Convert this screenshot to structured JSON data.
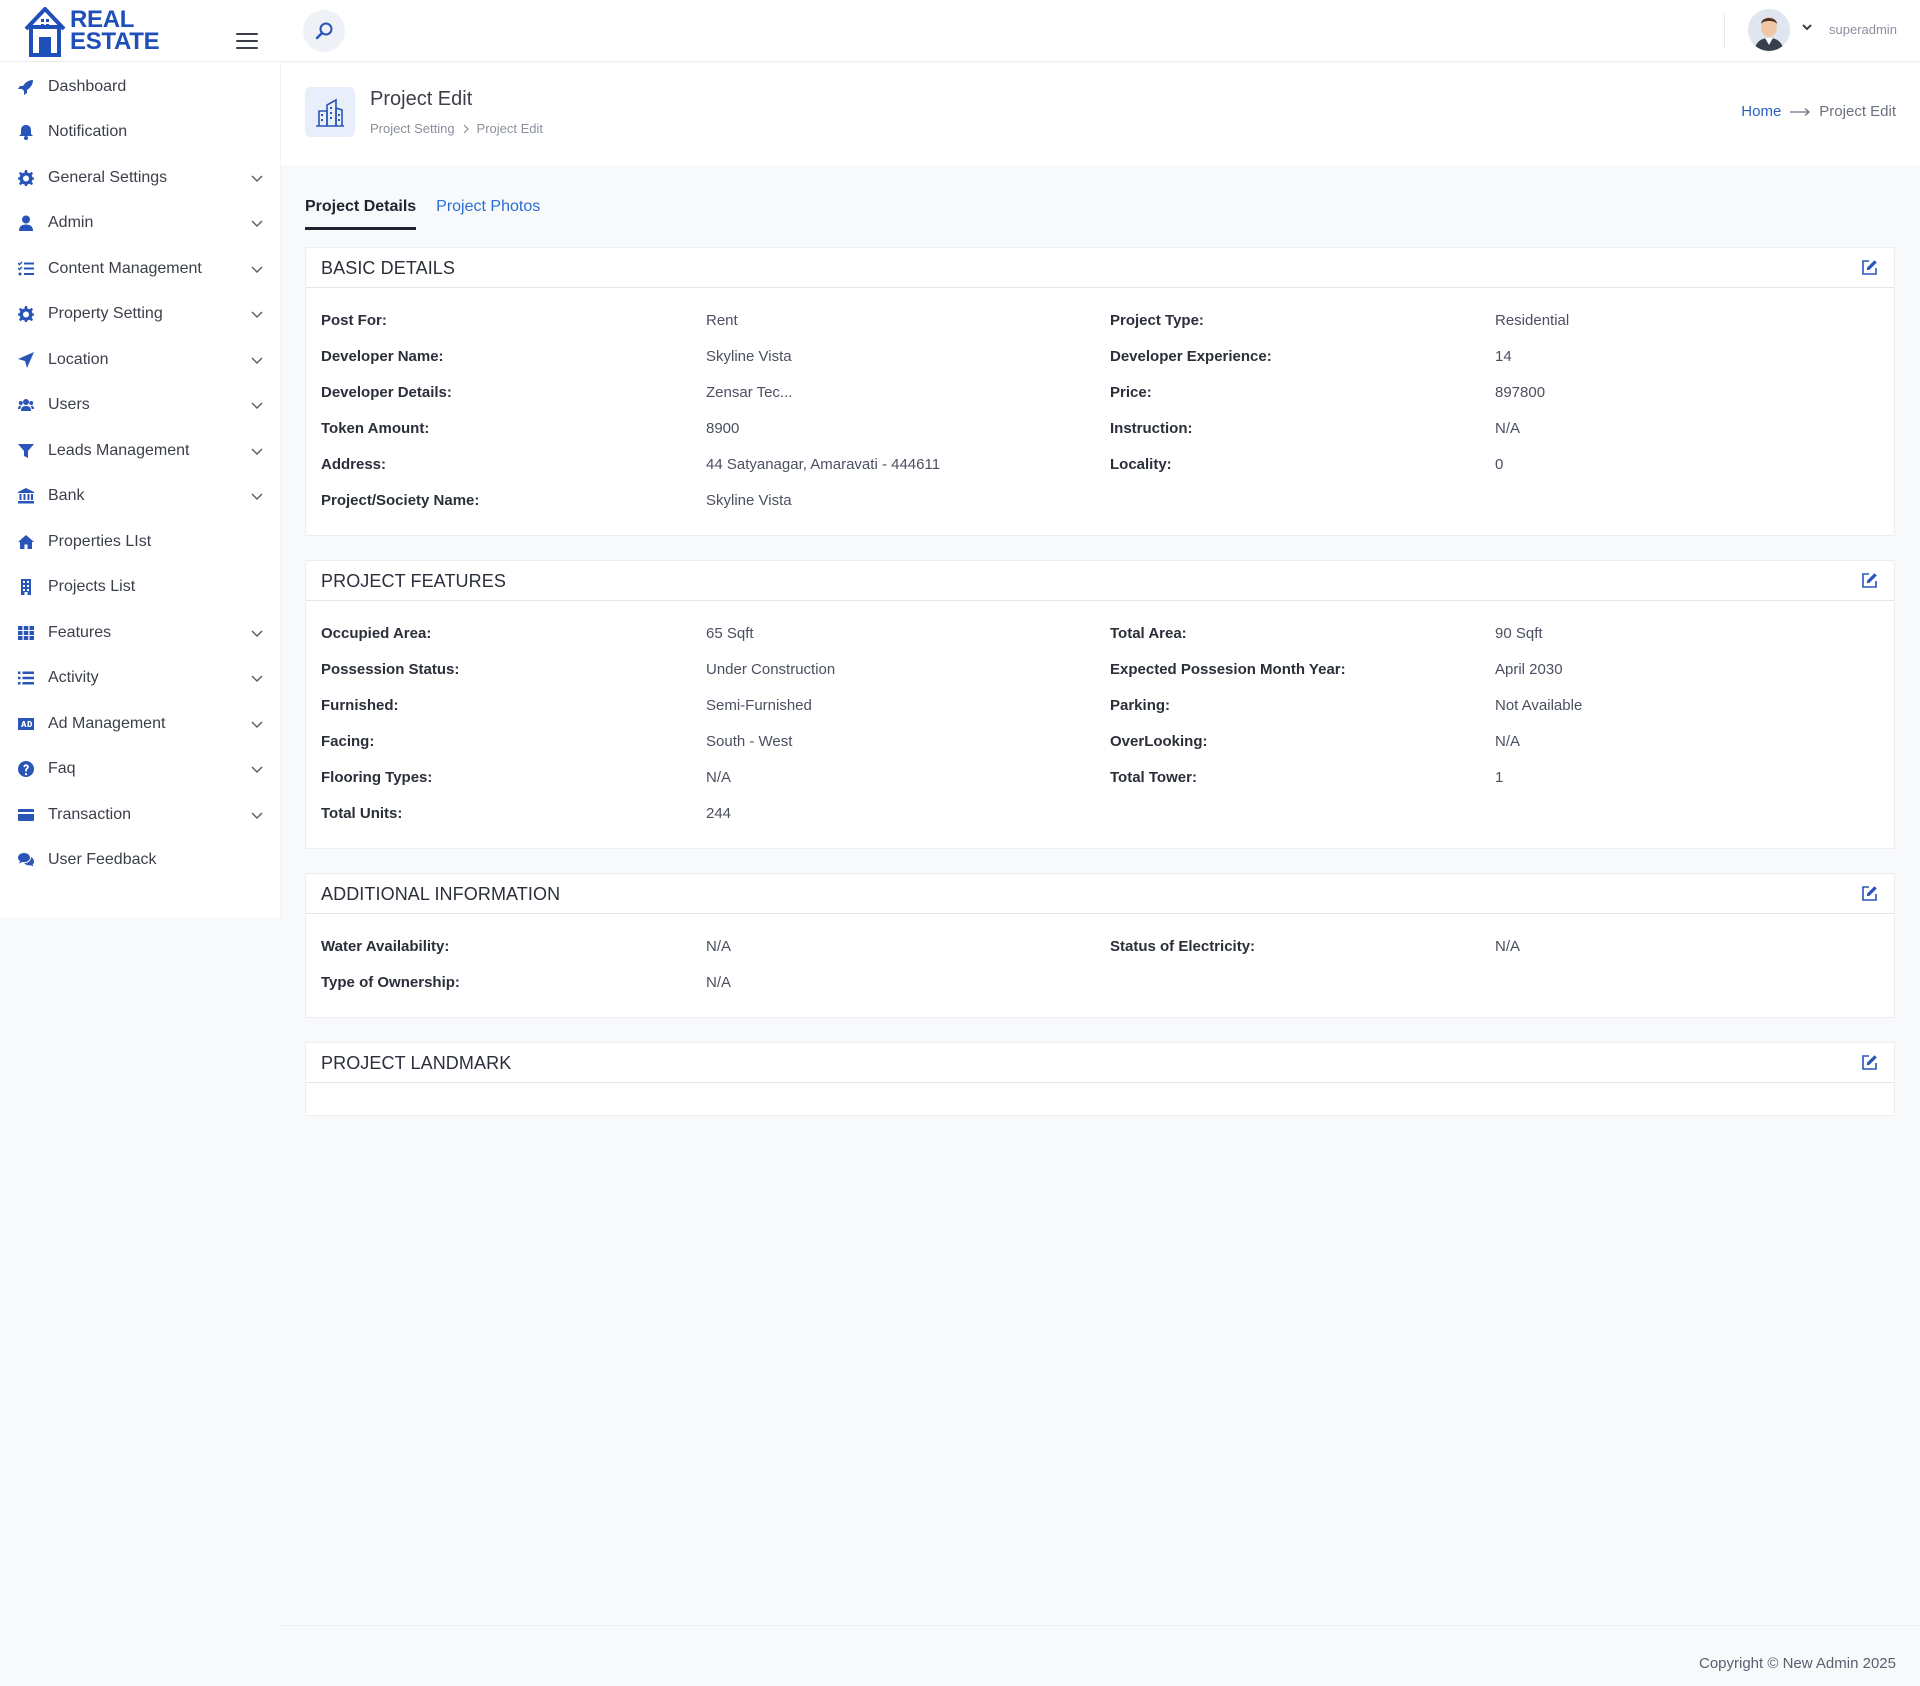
{
  "brand": {
    "line1": "REAL",
    "line2": "ESTATE"
  },
  "header": {
    "username": "superadmin"
  },
  "sidebar": {
    "items": [
      {
        "label": "Dashboard",
        "icon": "rocket-icon",
        "expandable": false
      },
      {
        "label": "Notification",
        "icon": "bell-icon",
        "expandable": false
      },
      {
        "label": "General Settings",
        "icon": "gear-icon",
        "expandable": true
      },
      {
        "label": "Admin",
        "icon": "user-icon",
        "expandable": true
      },
      {
        "label": "Content Management",
        "icon": "list-check-icon",
        "expandable": true
      },
      {
        "label": "Property Setting",
        "icon": "gear-icon",
        "expandable": true
      },
      {
        "label": "Location",
        "icon": "location-arrow-icon",
        "expandable": true
      },
      {
        "label": "Users",
        "icon": "users-icon",
        "expandable": true
      },
      {
        "label": "Leads Management",
        "icon": "funnel-icon",
        "expandable": true
      },
      {
        "label": "Bank",
        "icon": "bank-icon",
        "expandable": true
      },
      {
        "label": "Properties LIst",
        "icon": "home-icon",
        "expandable": false
      },
      {
        "label": "Projects List",
        "icon": "building-icon",
        "expandable": false
      },
      {
        "label": "Features",
        "icon": "grid-icon",
        "expandable": true
      },
      {
        "label": "Activity",
        "icon": "list-icon",
        "expandable": true
      },
      {
        "label": "Ad Management",
        "icon": "ad-icon",
        "expandable": true
      },
      {
        "label": "Faq",
        "icon": "question-circle-icon",
        "expandable": true
      },
      {
        "label": "Transaction",
        "icon": "credit-card-icon",
        "expandable": true
      },
      {
        "label": "User Feedback",
        "icon": "comments-icon",
        "expandable": false
      }
    ]
  },
  "page": {
    "title": "Project Edit",
    "subcrumb": [
      "Project Setting",
      "Project Edit"
    ],
    "breadcrumb": {
      "home": "Home",
      "current": "Project Edit"
    }
  },
  "tabs": [
    {
      "label": "Project Details",
      "active": true
    },
    {
      "label": "Project Photos",
      "active": false
    }
  ],
  "sections": {
    "basic": {
      "title": "BASIC DETAILS",
      "left": [
        {
          "label": "Post For:",
          "value": "Rent"
        },
        {
          "label": "Developer Name:",
          "value": "Skyline Vista"
        },
        {
          "label": "Developer Details:",
          "value": "Zensar Tec..."
        },
        {
          "label": "Token Amount:",
          "value": "8900"
        },
        {
          "label": "Address:",
          "value": "44 Satyanagar, Amaravati - 444611"
        },
        {
          "label": "Project/Society Name:",
          "value": "Skyline Vista"
        }
      ],
      "right": [
        {
          "label": "Project Type:",
          "value": "Residential"
        },
        {
          "label": "Developer Experience:",
          "value": "14"
        },
        {
          "label": "Price:",
          "value": "897800"
        },
        {
          "label": "Instruction:",
          "value": "N/A"
        },
        {
          "label": "Locality:",
          "value": "0"
        }
      ]
    },
    "features": {
      "title": "PROJECT FEATURES",
      "left": [
        {
          "label": "Occupied Area:",
          "value": "65 Sqft"
        },
        {
          "label": "Possession Status:",
          "value": "Under Construction"
        },
        {
          "label": "Furnished:",
          "value": "Semi-Furnished"
        },
        {
          "label": "Facing:",
          "value": "South - West"
        },
        {
          "label": "Flooring Types:",
          "value": "N/A"
        },
        {
          "label": "Total Units:",
          "value": "244"
        }
      ],
      "right": [
        {
          "label": "Total Area:",
          "value": "90 Sqft"
        },
        {
          "label": "Expected Possesion Month Year:",
          "value": "April 2030"
        },
        {
          "label": "Parking:",
          "value": "Not Available"
        },
        {
          "label": "OverLooking:",
          "value": "N/A"
        },
        {
          "label": "Total Tower:",
          "value": "1"
        }
      ]
    },
    "additional": {
      "title": "ADDITIONAL INFORMATION",
      "left": [
        {
          "label": "Water Availability:",
          "value": "N/A"
        },
        {
          "label": "Type of Ownership:",
          "value": "N/A"
        }
      ],
      "right": [
        {
          "label": "Status of Electricity:",
          "value": "N/A"
        }
      ]
    },
    "landmark": {
      "title": "PROJECT LANDMARK"
    }
  },
  "footer": {
    "copyright": "Copyright © New Admin 2025"
  },
  "colors": {
    "accent": "#2a55b8",
    "link": "#2a6ed6",
    "text": "#3b3f4a"
  }
}
